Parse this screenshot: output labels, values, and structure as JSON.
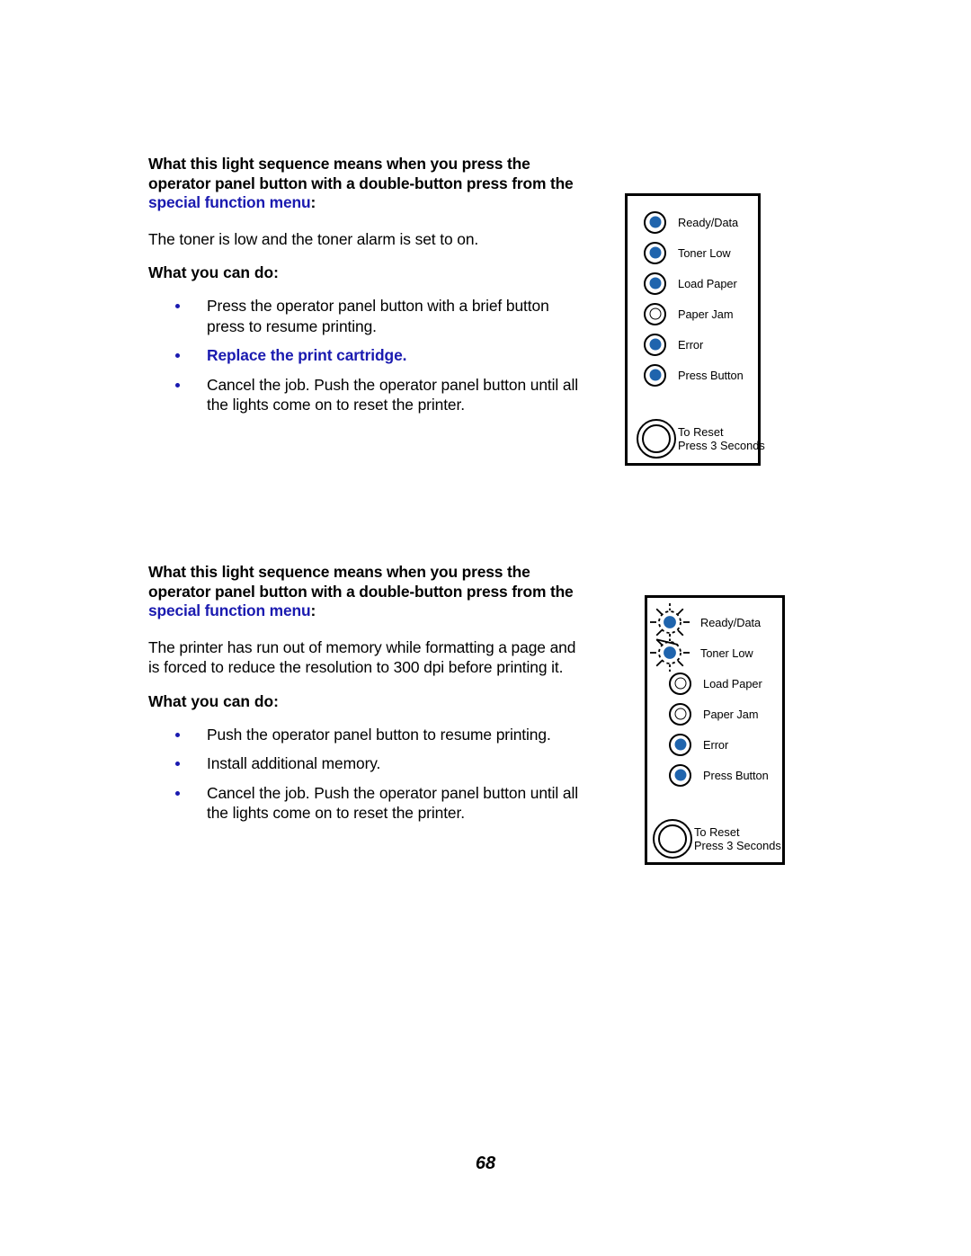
{
  "page": {
    "number": "68"
  },
  "sections": [
    {
      "heading_prefix": "What this light sequence means when you press the operator panel button with a double-button press from the ",
      "heading_link": "special function menu",
      "heading_suffix": ":",
      "description": "The toner is low and the toner alarm is set to on.",
      "subheading": "What you can do:",
      "bullets": [
        {
          "text": "Press the operator panel button with a brief button press to resume printing.",
          "is_link": false
        },
        {
          "text": "Replace the print cartridge.",
          "is_link": true
        },
        {
          "text": "Cancel the job. Push the operator panel button until all the lights come on to reset the printer.",
          "is_link": false
        }
      ]
    },
    {
      "heading_prefix": "What this light sequence means when you press the operator panel button with a double-button press from the ",
      "heading_link": "special function menu",
      "heading_suffix": ":",
      "description": "The printer has run out of memory while formatting a page and is forced to reduce the resolution to 300 dpi before printing it.",
      "subheading": "What you can do:",
      "bullets": [
        {
          "text": "Push the operator panel button to resume printing.",
          "is_link": false
        },
        {
          "text": "Install additional memory.",
          "is_link": false
        },
        {
          "text": "Cancel the job. Push the operator panel button until all the lights come on to reset the printer.",
          "is_link": false
        }
      ]
    }
  ],
  "panels": [
    {
      "id": "panel-1",
      "leds": [
        {
          "label": "Ready/Data",
          "state": "on"
        },
        {
          "label": "Toner Low",
          "state": "on"
        },
        {
          "label": "Load Paper",
          "state": "on"
        },
        {
          "label": "Paper Jam",
          "state": "off"
        },
        {
          "label": "Error",
          "state": "on"
        },
        {
          "label": "Press Button",
          "state": "on"
        }
      ],
      "reset": {
        "line1": "To Reset",
        "line2": "Press 3 Seconds"
      }
    },
    {
      "id": "panel-2",
      "leds": [
        {
          "label": "Ready/Data",
          "state": "blinking"
        },
        {
          "label": "Toner Low",
          "state": "blinking"
        },
        {
          "label": "Load Paper",
          "state": "off"
        },
        {
          "label": "Paper Jam",
          "state": "off"
        },
        {
          "label": "Error",
          "state": "on"
        },
        {
          "label": "Press Button",
          "state": "on"
        }
      ],
      "reset": {
        "line1": "To Reset",
        "line2": "Press 3 Seconds"
      }
    }
  ],
  "colors": {
    "link": "#1A1AB0",
    "led_on": "#1F64AD",
    "ink": "#000000",
    "paper": "#FFFFFF"
  }
}
